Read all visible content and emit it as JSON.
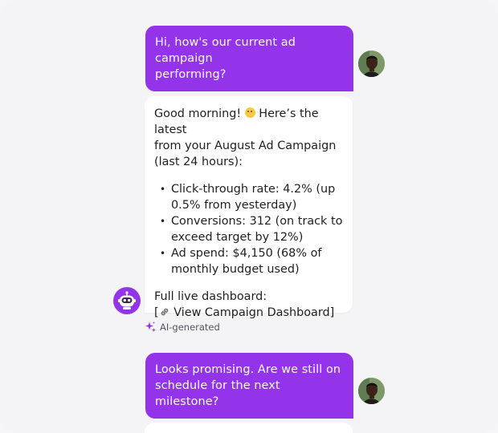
{
  "messages": {
    "user1": {
      "line1": "Hi, how's our current ad campaign",
      "line2": "performing?"
    },
    "bot1": {
      "intro_a": "Good morning! ",
      "intro_b": " Here’s the latest",
      "intro_line2": "from your August Ad Campaign",
      "intro_line3": "(last 24 hours):",
      "bullets": [
        {
          "l1": "Click-through rate: 4.2% (up",
          "l2": "0.5% from yesterday)"
        },
        {
          "l1": "Conversions: 312 (on track to",
          "l2": "exceed target by 12%)"
        },
        {
          "l1": "Ad spend: $4,150 (68% of",
          "l2": "monthly budget used)"
        }
      ],
      "dashboard_label": "Full live dashboard:",
      "dashboard_link_open": "[",
      "dashboard_link_text": " View Campaign Dashboard",
      "dashboard_link_close": "]"
    },
    "ai_tag": "AI-generated",
    "user2": {
      "line1": "Looks promising. Are we still on",
      "line2": "schedule for the next milestone?"
    }
  },
  "icons": {
    "emoji": "slightly-smiling-face-emoji",
    "link": "link-icon",
    "sparkle": "sparkle-icon",
    "bot": "robot-avatar"
  },
  "colors": {
    "accent": "#9333ea",
    "background": "#f4f4f6",
    "bot_bubble": "#ffffff"
  }
}
